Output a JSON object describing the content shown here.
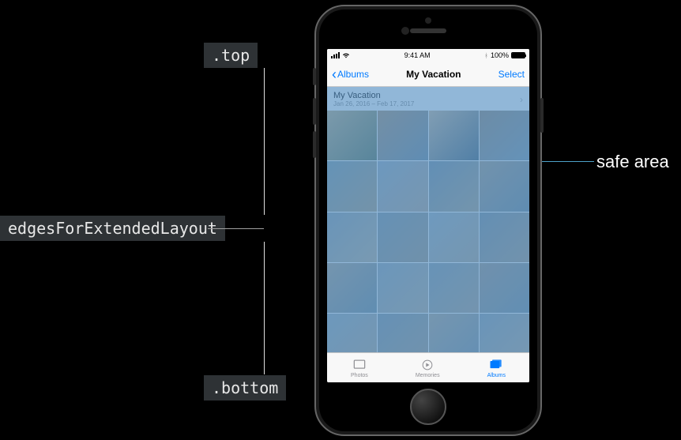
{
  "annotations": {
    "top": ".top",
    "bottom": ".bottom",
    "edges": "edgesForExtendedLayout",
    "safe_area": "safe area"
  },
  "status_bar": {
    "time": "9:41 AM",
    "battery_pct": "100%"
  },
  "nav": {
    "back_label": "Albums",
    "title": "My Vacation",
    "select_label": "Select"
  },
  "section": {
    "title": "My Vacation",
    "subtitle": "Jan 26, 2016 – Feb 17, 2017"
  },
  "tabs": [
    {
      "label": "Photos"
    },
    {
      "label": "Memories"
    },
    {
      "label": "Albums"
    }
  ],
  "colors": {
    "ios_tint": "#007aff",
    "safe_overlay": "rgba(60,130,190,0.55)"
  }
}
